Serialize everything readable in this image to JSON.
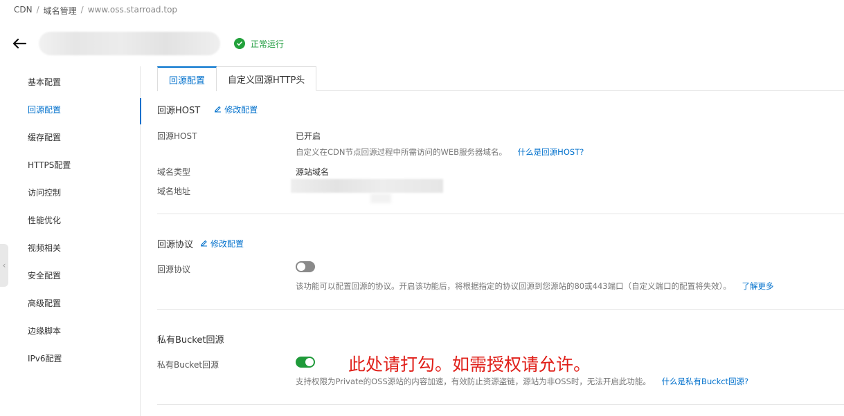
{
  "breadcrumb": {
    "root": "CDN",
    "sep1": "/",
    "middle": "域名管理",
    "sep2": "/",
    "current": "www.oss.starroad.top"
  },
  "header": {
    "status": "正常运行",
    "status_color": "#22a13b"
  },
  "sidebar": {
    "items": [
      {
        "label": "基本配置"
      },
      {
        "label": "回源配置",
        "active": true
      },
      {
        "label": "缓存配置"
      },
      {
        "label": "HTTPS配置"
      },
      {
        "label": "访问控制"
      },
      {
        "label": "性能优化"
      },
      {
        "label": "视频相关"
      },
      {
        "label": "安全配置"
      },
      {
        "label": "高级配置"
      },
      {
        "label": "边缘脚本"
      },
      {
        "label": "IPv6配置"
      }
    ],
    "collapse_icon": "chevron-left-icon"
  },
  "tabs": [
    {
      "label": "回源配置",
      "active": true
    },
    {
      "label": "自定义回源HTTP头"
    }
  ],
  "host_section": {
    "title": "回源HOST",
    "edit": "修改配置",
    "host_label": "回源HOST",
    "host_value": "已开启",
    "host_desc": "自定义在CDN节点回源过程中所需访问的WEB服务器域名。",
    "host_link": "什么是回源HOST?",
    "type_label": "域名类型",
    "type_value": "源站域名",
    "addr_label": "域名地址"
  },
  "protocol_section": {
    "title": "回源协议",
    "edit": "修改配置",
    "label": "回源协议",
    "switch_on": false,
    "desc": "该功能可以配置回源的协议。开启该功能后，将根据指定的协议回源到您源站的80或443端口（自定义端口的配置将失效）。",
    "link": "了解更多"
  },
  "bucket_section": {
    "title": "私有Bucket回源",
    "label": "私有Bucket回源",
    "switch_on": true,
    "desc": "支持权限为Private的OSS源站的内容加速，有效防止资源盗链，源站为非OSS时，无法开启此功能。",
    "link": "什么是私有Buckct回源?"
  },
  "annotation": "此处请打勾。如需授权请允许。",
  "colors": {
    "accent": "#0070cc",
    "success": "#22a13b",
    "annotation": "#e0201a"
  }
}
